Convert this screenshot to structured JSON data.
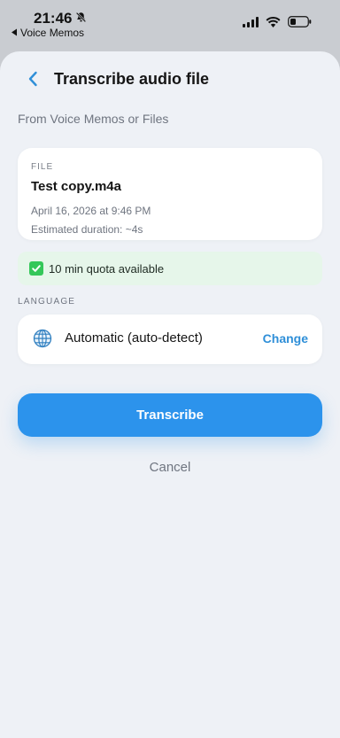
{
  "status_bar": {
    "time": "21:46",
    "back_app_label": "Voice Memos"
  },
  "header": {
    "title": "Transcribe audio file",
    "subtitle": "From Voice Memos or Files"
  },
  "file": {
    "section_label": "FILE",
    "name": "Test copy.m4a",
    "date": "April 16, 2026 at 9:46 PM",
    "duration": "Estimated duration: ~4s"
  },
  "quota": {
    "text": "10 min quota available"
  },
  "language": {
    "section_label": "LANGUAGE",
    "value": "Automatic (auto-detect)",
    "change_label": "Change"
  },
  "actions": {
    "transcribe_label": "Transcribe",
    "cancel_label": "Cancel"
  },
  "colors": {
    "accent": "#2c93ec",
    "link": "#2f8fd8",
    "quota_bg": "#e6f6ea",
    "check_green": "#34c759",
    "sheet_bg": "#eef1f6"
  },
  "icons": [
    "bell-slash-icon",
    "back-chevron-icon",
    "signal-icon",
    "wifi-icon",
    "battery-icon",
    "chevron-left-icon",
    "check-icon",
    "globe-icon"
  ]
}
